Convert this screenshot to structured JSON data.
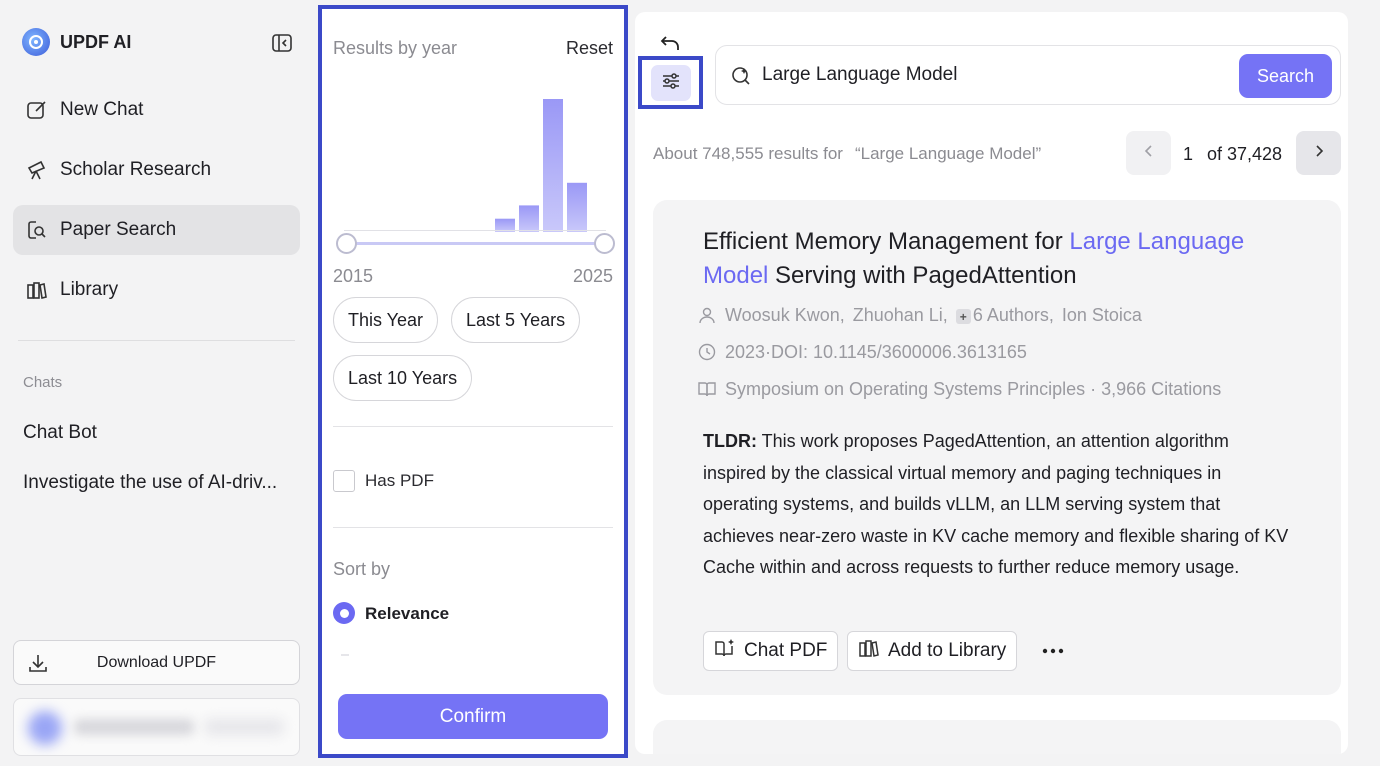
{
  "app": {
    "name": "UPDF AI"
  },
  "sidebar": {
    "items": [
      {
        "label": "New Chat",
        "icon": "edit-icon"
      },
      {
        "label": "Scholar Research",
        "icon": "telescope-icon"
      },
      {
        "label": "Paper Search",
        "icon": "paper-search-icon",
        "active": true
      },
      {
        "label": "Library",
        "icon": "library-icon"
      }
    ],
    "chats_label": "Chats",
    "chats": [
      "Chat Bot",
      "Investigate the use of AI-driv..."
    ],
    "download_label": "Download UPDF"
  },
  "filter": {
    "title": "Results by year",
    "reset_label": "Reset",
    "year_start": "2015",
    "year_end": "2025",
    "histogram": [
      0,
      0,
      0,
      0,
      0,
      0,
      0.1,
      0.2,
      1.0,
      0.37,
      0
    ],
    "quick_ranges": [
      "This Year",
      "Last 5 Years",
      "Last 10 Years"
    ],
    "has_pdf_label": "Has PDF",
    "has_pdf_checked": false,
    "sort_by_label": "Sort by",
    "sort_selected": "Relevance",
    "confirm_label": "Confirm"
  },
  "search": {
    "query": "Large Language Model",
    "button_label": "Search"
  },
  "results": {
    "summary": "About 748,555 results for",
    "query_quoted": "“Large Language Model”",
    "page": "1",
    "of_pages": "of 37,428"
  },
  "paper": {
    "title_before": "Efficient Memory Management for ",
    "title_highlight": "Large Language Model",
    "title_after": " Serving with PagedAttention",
    "authors": [
      "Woosuk Kwon,",
      "Zhuohan Li,",
      "6 Authors,",
      "Ion Stoica"
    ],
    "year_doi": "2023·DOI: 10.1145/3600006.3613165",
    "venue_citations": "Symposium on Operating Systems Principles · 3,966 Citations",
    "tldr_label": "TLDR:",
    "tldr_text": " This work proposes PagedAttention, an attention algorithm inspired by the classical virtual memory and paging techniques in operating systems, and builds vLLM, an LLM serving system that achieves near-zero waste in KV cache memory and flexible sharing of KV Cache within and across requests to further reduce memory usage.",
    "actions": {
      "chat_pdf": "Chat PDF",
      "add_library": "Add to Library",
      "more": "···"
    }
  },
  "colors": {
    "accent": "#7573f5",
    "highlight_frame": "#3b49c8",
    "link": "#6b69f2"
  }
}
